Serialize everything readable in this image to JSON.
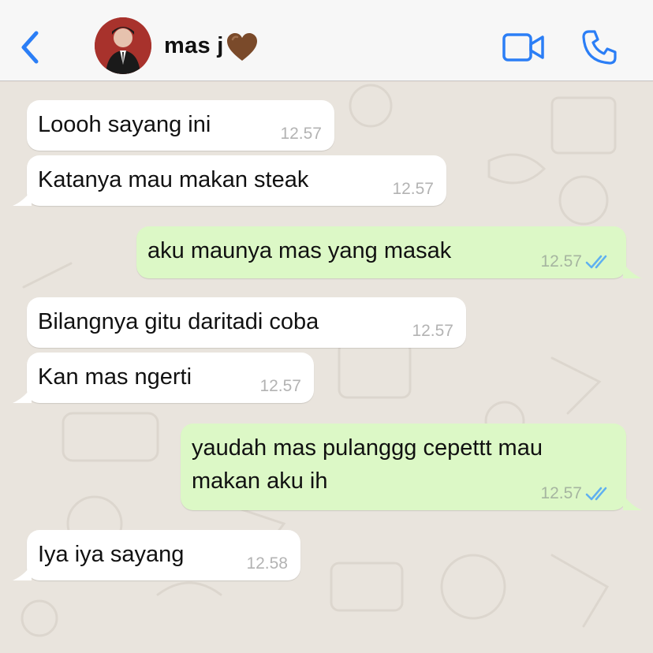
{
  "header": {
    "contact_name": "mas j",
    "back_icon": "chevron-left-icon",
    "video_icon": "video-camera-icon",
    "call_icon": "phone-icon",
    "accent_color": "#2b7ef6"
  },
  "messages": [
    {
      "direction": "incoming",
      "text": "Loooh sayang ini",
      "time": "12.57"
    },
    {
      "direction": "incoming",
      "text": "Katanya mau makan steak",
      "time": "12.57"
    },
    {
      "direction": "outgoing",
      "text": "aku maunya mas yang masak",
      "time": "12.57",
      "status": "read"
    },
    {
      "direction": "incoming",
      "text": "Bilangnya gitu daritadi coba",
      "time": "12.57"
    },
    {
      "direction": "incoming",
      "text": "Kan mas ngerti",
      "time": "12.57"
    },
    {
      "direction": "outgoing",
      "text_line1": "yaudah mas pulanggg cepettt mau",
      "text_line2": "makan aku ih",
      "time": "12.57",
      "status": "read"
    },
    {
      "direction": "incoming",
      "text": "Iya iya sayang",
      "time": "12.58"
    }
  ],
  "colors": {
    "incoming_bubble": "#ffffff",
    "outgoing_bubble": "#dcf8c6",
    "read_ticks": "#5fb0f0",
    "chat_background": "#e9e4dd"
  }
}
